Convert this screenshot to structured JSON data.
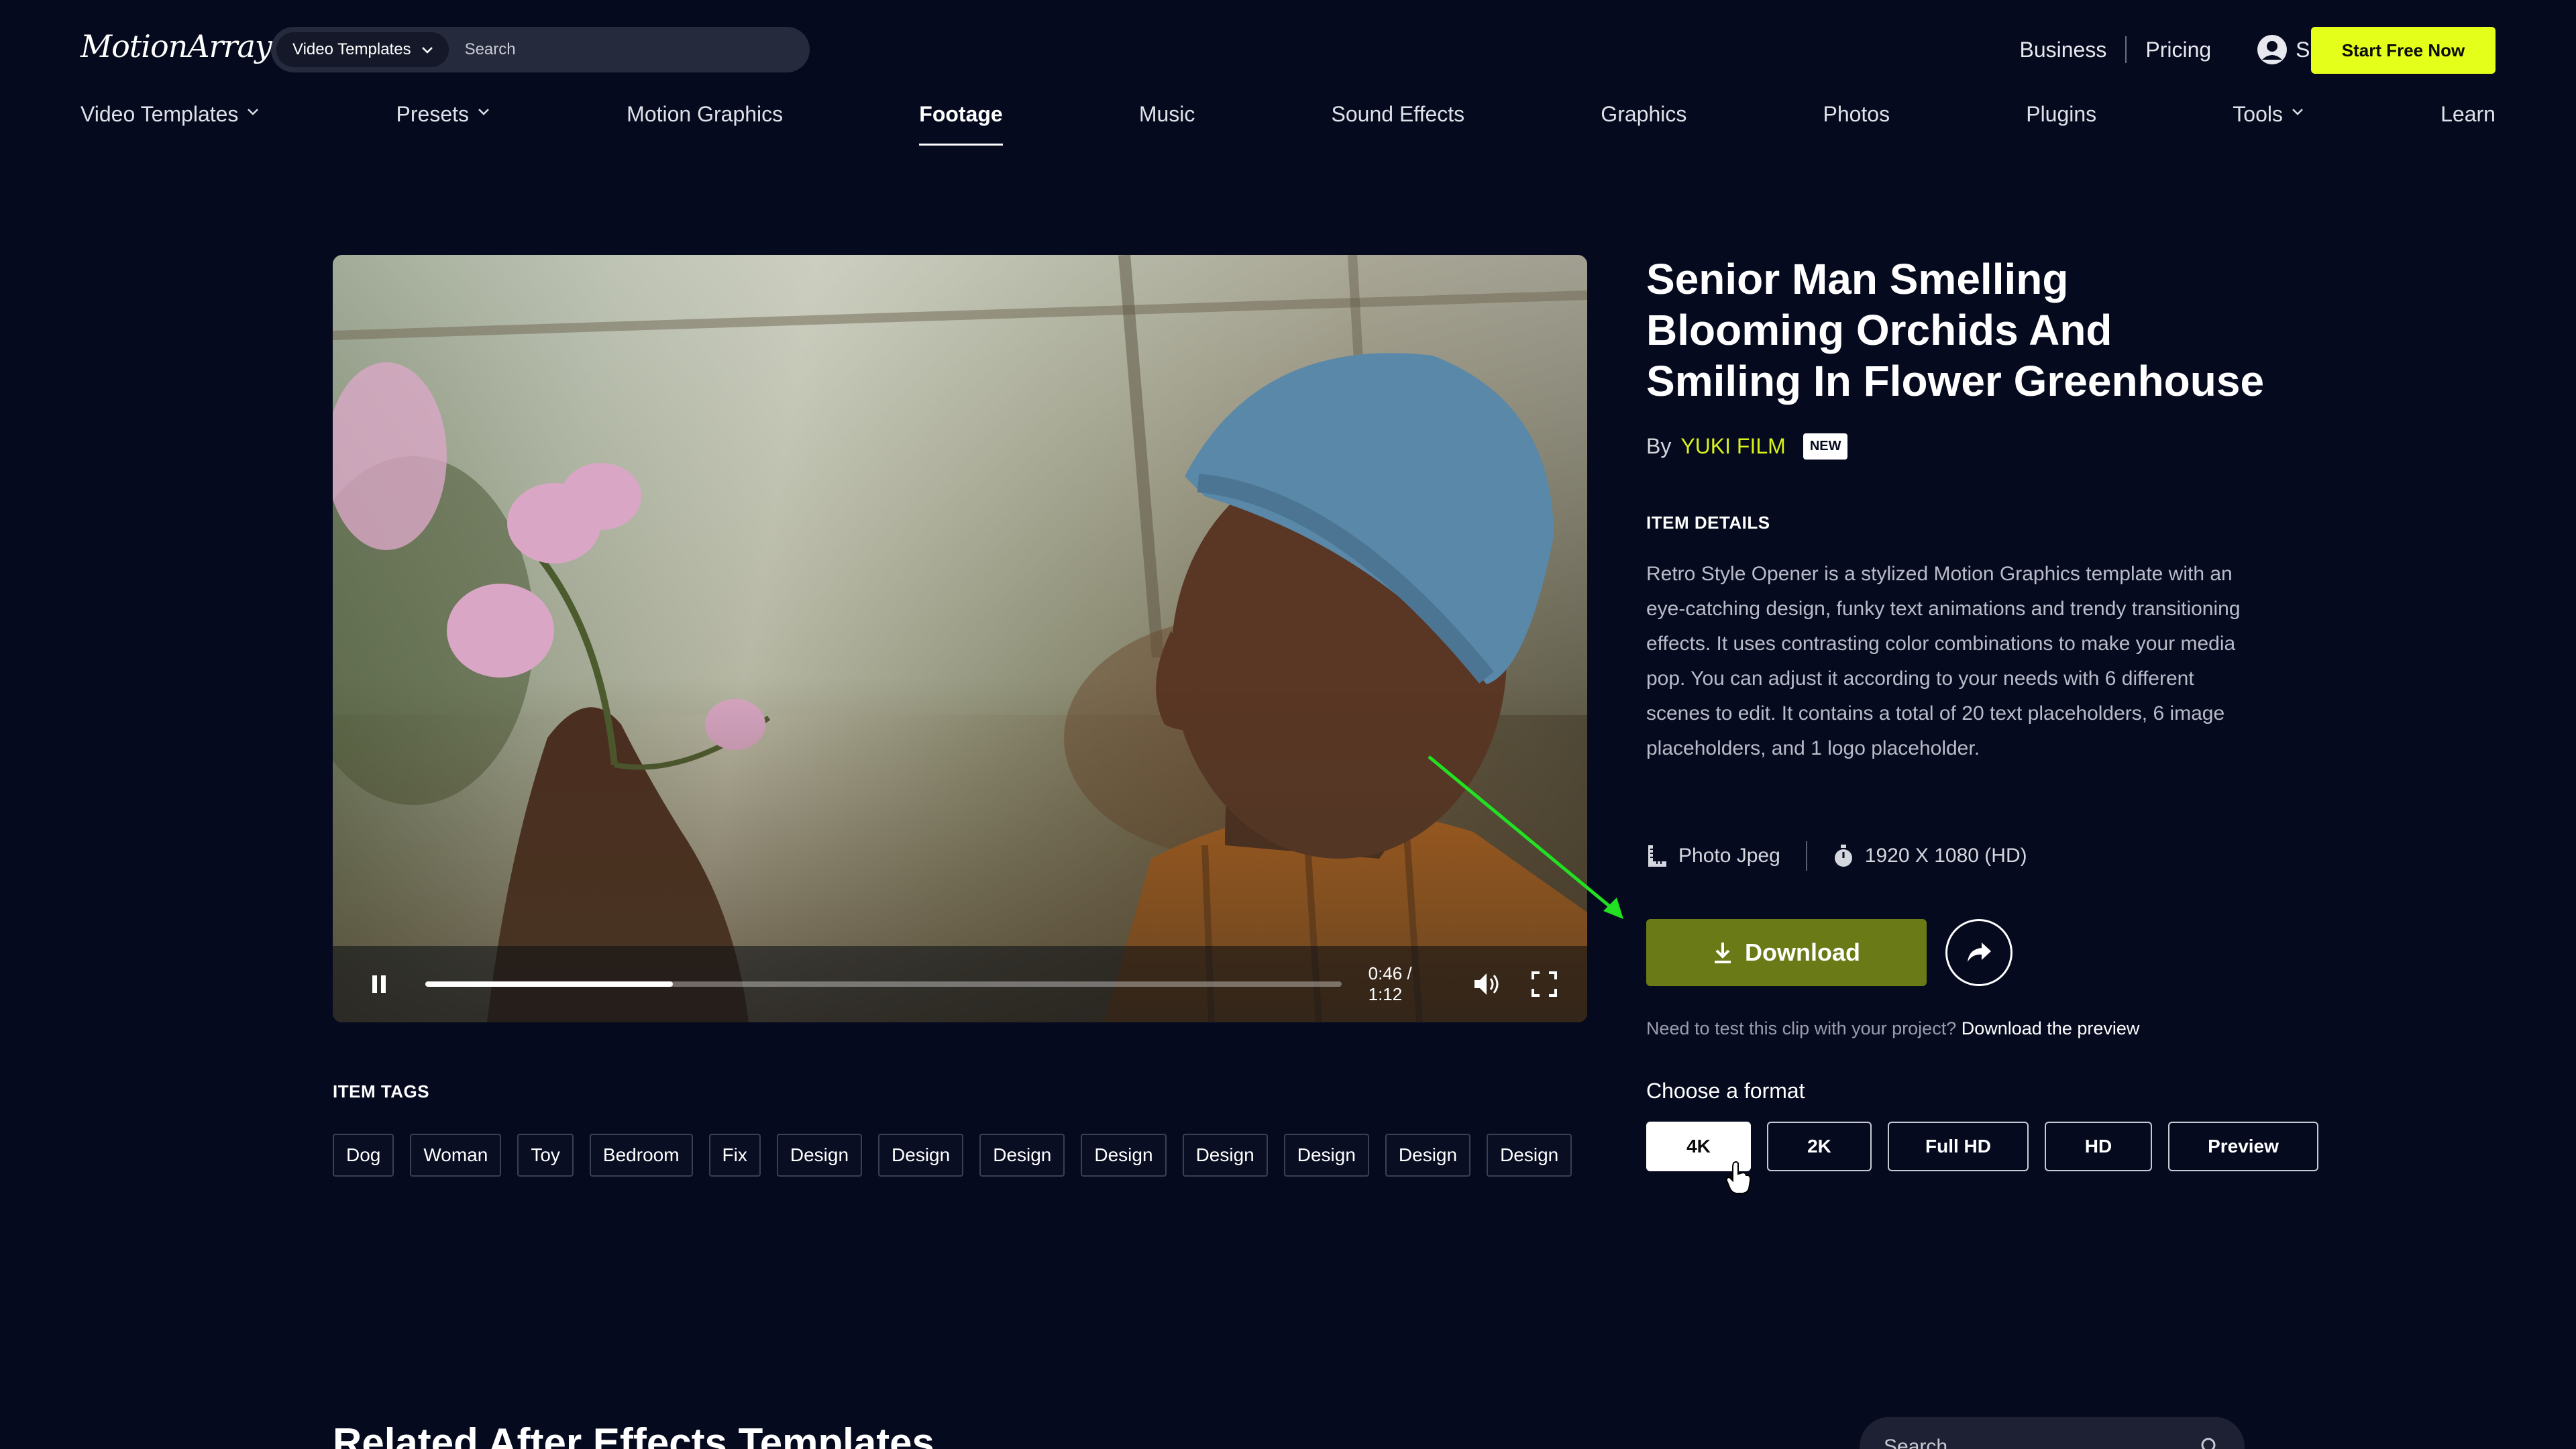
{
  "header": {
    "logo": "MotionArray",
    "search_category": "Video Templates",
    "search_placeholder": "Search",
    "links": [
      "Business",
      "Pricing"
    ],
    "sign_in": "Sign in",
    "cta": "Start Free Now"
  },
  "nav": {
    "items": [
      {
        "label": "Video Templates",
        "dropdown": true
      },
      {
        "label": "Presets",
        "dropdown": true
      },
      {
        "label": "Motion Graphics",
        "dropdown": false
      },
      {
        "label": "Footage",
        "dropdown": false,
        "active": true
      },
      {
        "label": "Music",
        "dropdown": false
      },
      {
        "label": "Sound Effects",
        "dropdown": false
      },
      {
        "label": "Graphics",
        "dropdown": false
      },
      {
        "label": "Photos",
        "dropdown": false
      },
      {
        "label": "Plugins",
        "dropdown": false
      },
      {
        "label": "Tools",
        "dropdown": true
      },
      {
        "label": "Learn",
        "dropdown": false
      }
    ]
  },
  "video": {
    "time": "0:46 / 1:12",
    "progress": 0.27
  },
  "item": {
    "title": "Senior Man Smelling Blooming Orchids And Smiling In Flower Greenhouse",
    "by": "By",
    "author": "YUKI FILM",
    "badge": "NEW",
    "details_heading": "ITEM DETAILS",
    "description": "Retro Style Opener is a stylized Motion Graphics template with an eye-catching design, funky text animations and trendy transitioning effects. It uses contrasting color combinations to make your media pop. You can adjust it according to your needs with 6 different scenes to edit. It contains a total of 20 text placeholders, 6 image placeholders, and 1 logo placeholder.",
    "codec": "Photo Jpeg",
    "resolution": "1920 X 1080 (HD)",
    "download_label": "Download",
    "preview_note": "Need to test this clip with your project?",
    "preview_link": "Download the preview",
    "format_heading": "Choose a format",
    "formats": [
      {
        "label": "4K",
        "selected": true
      },
      {
        "label": "2K",
        "selected": false
      },
      {
        "label": "Full HD",
        "selected": false
      },
      {
        "label": "HD",
        "selected": false
      },
      {
        "label": "Preview",
        "selected": false
      }
    ]
  },
  "tags": {
    "heading": "ITEM TAGS",
    "items": [
      "Dog",
      "Woman",
      "Toy",
      "Bedroom",
      "Fix",
      "Design",
      "Design",
      "Design",
      "Design",
      "Design",
      "Design",
      "Design",
      "Design"
    ]
  },
  "related": {
    "heading": "Related After Effects Templates",
    "search_placeholder": "Search"
  },
  "colors": {
    "background": "#060a1f",
    "accent": "#e4ff1a",
    "author": "#d8f21a",
    "download": "#6a7a17",
    "annotation_arrow": "#22e022"
  }
}
